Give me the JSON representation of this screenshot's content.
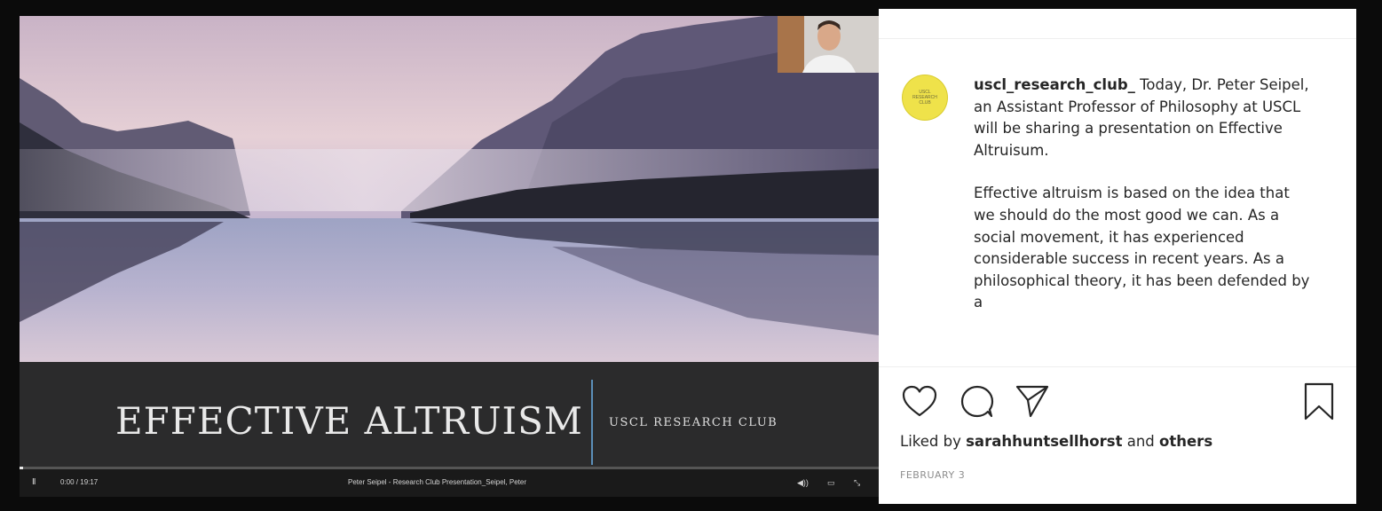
{
  "video": {
    "slide_title": "EFFECTIVE ALTRUISM",
    "slide_subtitle": "USCL RESEARCH CLUB",
    "time": "0:00 / 19:17",
    "progress": 0.0,
    "video_title": "Peter Seipel - Research Club Presentation_Seipel, Peter",
    "pause_icon": "II",
    "volume_icon": "◀))",
    "cc_icon": "▭",
    "fullscreen_icon": "⤡"
  },
  "post": {
    "avatar_text": [
      "USCL",
      "RESEARCH",
      "CLUB"
    ],
    "username": "uscl_research_club_",
    "caption_p1": "Today, Dr. Peter Seipel, an Assistant Professor of Philosophy at USCL will be sharing a presentation on Effective Altruisum.",
    "caption_p2": "Effective altruism is based on the idea that we should do the most good we can. As a social movement, it has experienced considerable success in recent years. As a philosophical theory, it has been defended by a",
    "liked_prefix": "Liked by",
    "liked_user": "sarahhuntsellhorst",
    "liked_and": "and",
    "liked_others": "others",
    "date": "FEBRUARY 3"
  },
  "colors": {
    "avatar_bg": "#efe24a",
    "divider_accent": "#5b8fb9"
  }
}
